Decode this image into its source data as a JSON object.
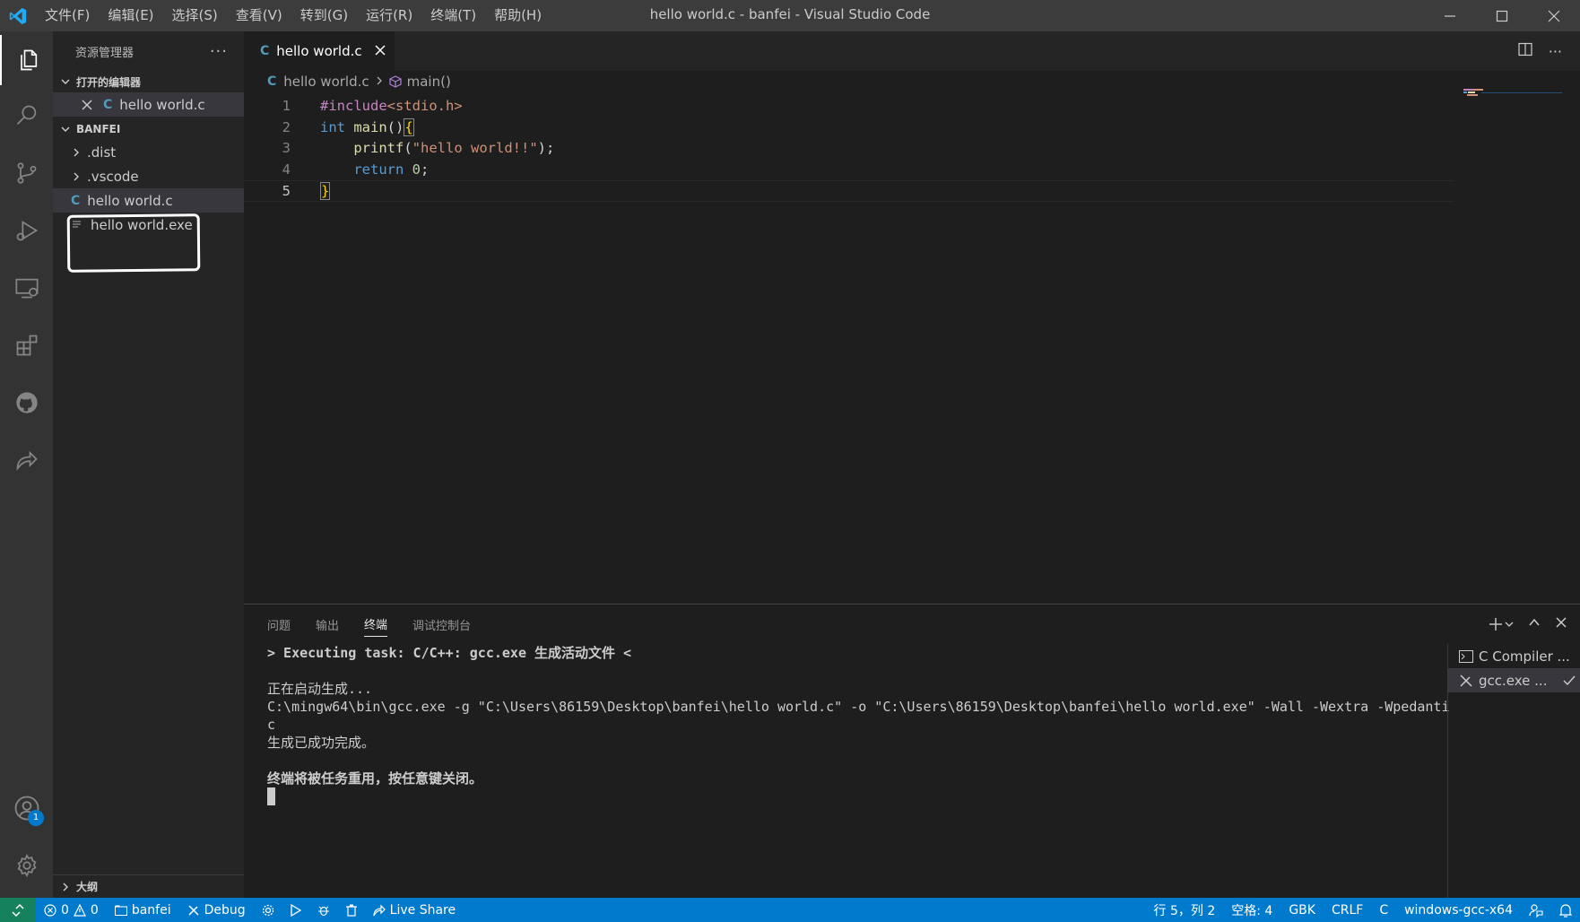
{
  "titlebar": {
    "menu": [
      "文件(F)",
      "编辑(E)",
      "选择(S)",
      "查看(V)",
      "转到(G)",
      "运行(R)",
      "终端(T)",
      "帮助(H)"
    ],
    "window_title": "hello world.c - banfei - Visual Studio Code"
  },
  "activitybar": {
    "items": [
      "files-icon",
      "search-icon",
      "source-control-icon",
      "run-debug-icon",
      "remote-explorer-icon",
      "extensions-icon",
      "github-icon",
      "live-share-icon"
    ],
    "account_badge": "1"
  },
  "sidebar": {
    "title": "资源管理器",
    "open_editors_title": "打开的编辑器",
    "open_editor_file": "hello world.c",
    "folder_title": "BANFEI",
    "tree": [
      {
        "type": "folder",
        "name": ".dist"
      },
      {
        "type": "folder",
        "name": ".vscode"
      },
      {
        "type": "c",
        "name": "hello world.c"
      },
      {
        "type": "exe",
        "name": "hello world.exe"
      }
    ],
    "outline_title": "大纲"
  },
  "editor": {
    "tab_label": "hello world.c",
    "tab_icon": "C",
    "breadcrumb_file": "hello world.c",
    "breadcrumb_symbol": "main()",
    "line_numbers": [
      "1",
      "2",
      "3",
      "4",
      "5"
    ],
    "code": {
      "l1_directive": "#include",
      "l1_header": "<stdio.h>",
      "l2_type": "int",
      "l2_fn": " main",
      "l2_rest": "()",
      "l2_brace": "{",
      "l3_indent": "    ",
      "l3_fn": "printf",
      "l3_open": "(",
      "l3_str": "\"hello world!!\"",
      "l3_close": ");",
      "l4_indent": "    ",
      "l4_kw": "return",
      "l4_num": "0",
      "l4_semi": ";",
      "l5_brace": "}"
    }
  },
  "panel": {
    "tabs": [
      "问题",
      "输出",
      "终端",
      "调试控制台"
    ],
    "active_tab": "终端",
    "terminal_lines": [
      "> Executing task: C/C++: gcc.exe 生成活动文件 <",
      "",
      "正在启动生成...",
      "C:\\mingw64\\bin\\gcc.exe -g \"C:\\Users\\86159\\Desktop\\banfei\\hello world.c\" -o \"C:\\Users\\86159\\Desktop\\banfei\\hello world.exe\" -Wall -Wextra -Wpedantic",
      "生成已成功完成。",
      "",
      "终端将被任务重用，按任意键关闭。"
    ],
    "terminal_instances": [
      "C Compiler ...",
      "gcc.exe ..."
    ]
  },
  "statusbar": {
    "errors": "0",
    "warnings": "0",
    "folder": "banfei",
    "debug": "Debug",
    "live_share": "Live Share",
    "position": "行 5，列 2",
    "spaces": "空格: 4",
    "encoding": "GBK",
    "eol": "CRLF",
    "language": "C",
    "config": "windows-gcc-x64"
  }
}
